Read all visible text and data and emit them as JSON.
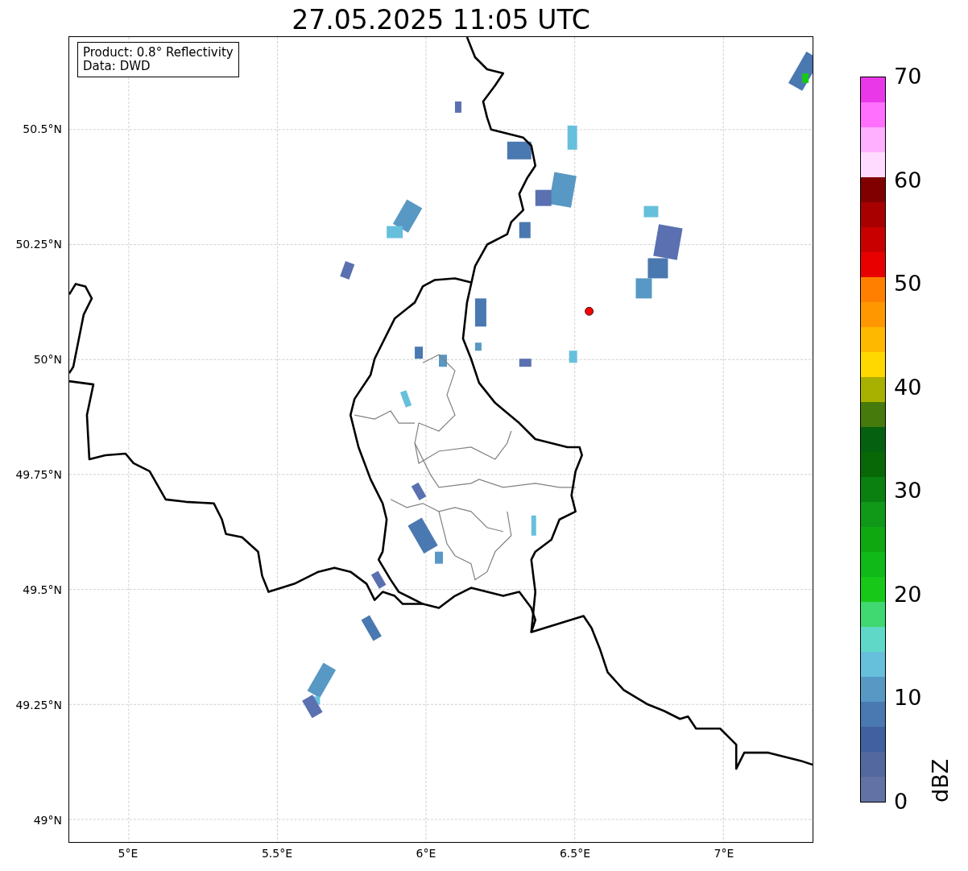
{
  "title": "27.05.2025 11:05 UTC",
  "info_box": {
    "lines": [
      "Product: 0.8° Reflectivity",
      "Data: DWD"
    ]
  },
  "map": {
    "lat_ticks": [
      "50.5°N",
      "50.25°N",
      "50°N",
      "49.75°N",
      "49.5°N",
      "49.25°N",
      "49°N"
    ],
    "lon_ticks": [
      "5°E",
      "5.5°E",
      "6°E",
      "6.5°E",
      "7°E"
    ]
  },
  "colorbar": {
    "label": "dBZ",
    "ticks": [
      "70",
      "60",
      "50",
      "40",
      "30",
      "20",
      "10",
      "0"
    ],
    "segments": [
      {
        "color": "#6272a4"
      },
      {
        "color": "#52689f"
      },
      {
        "color": "#4160a0"
      },
      {
        "color": "#4a78b0"
      },
      {
        "color": "#5898c4"
      },
      {
        "color": "#66c0dc"
      },
      {
        "color": "#60d8c8"
      },
      {
        "color": "#40d870"
      },
      {
        "color": "#18c818"
      },
      {
        "color": "#10b818"
      },
      {
        "color": "#10a810"
      },
      {
        "color": "#109818"
      },
      {
        "color": "#0a8010"
      },
      {
        "color": "#086808"
      },
      {
        "color": "#056010"
      },
      {
        "color": "#467a0c"
      },
      {
        "color": "#a8b000"
      },
      {
        "color": "#ffd800"
      },
      {
        "color": "#ffb800"
      },
      {
        "color": "#ff9800"
      },
      {
        "color": "#ff8000"
      },
      {
        "color": "#e80000"
      },
      {
        "color": "#c80000"
      },
      {
        "color": "#a80000"
      },
      {
        "color": "#800000"
      },
      {
        "color": "#ffdcff"
      },
      {
        "color": "#ffb0ff"
      },
      {
        "color": "#ff70ff"
      },
      {
        "color": "#e838e8"
      }
    ]
  }
}
